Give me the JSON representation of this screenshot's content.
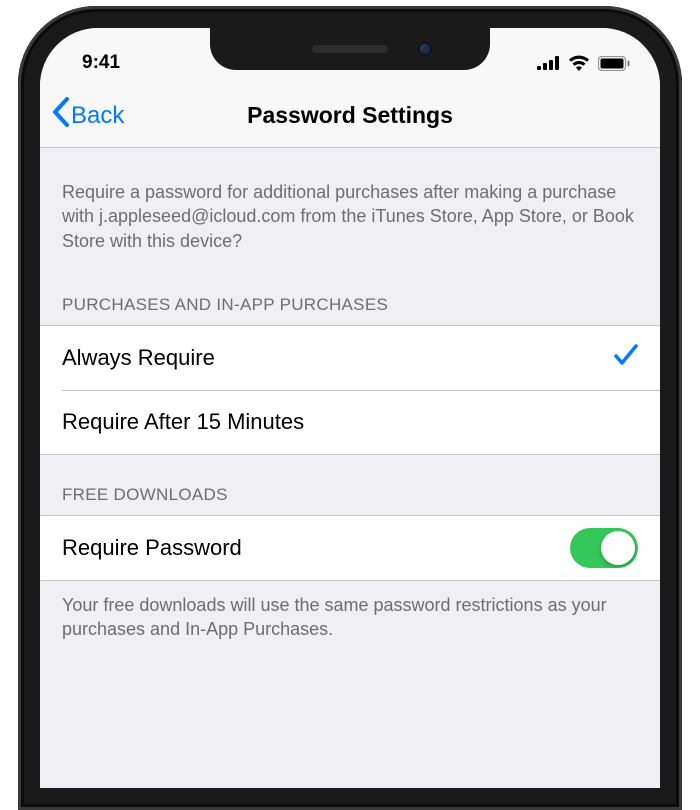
{
  "statusBar": {
    "time": "9:41"
  },
  "navBar": {
    "backLabel": "Back",
    "title": "Password Settings"
  },
  "intro": {
    "text": "Require a password for additional purchases after making a purchase with j.appleseed@icloud.com from the iTunes Store, App Store, or Book Store with this device?"
  },
  "sections": {
    "purchases": {
      "header": "PURCHASES AND IN-APP PURCHASES",
      "options": [
        {
          "label": "Always Require",
          "selected": true
        },
        {
          "label": "Require After 15 Minutes",
          "selected": false
        }
      ]
    },
    "freeDownloads": {
      "header": "FREE DOWNLOADS",
      "toggleLabel": "Require Password",
      "toggleOn": true,
      "footer": "Your free downloads will use the same password restrictions as your purchases and In-App Purchases."
    }
  }
}
